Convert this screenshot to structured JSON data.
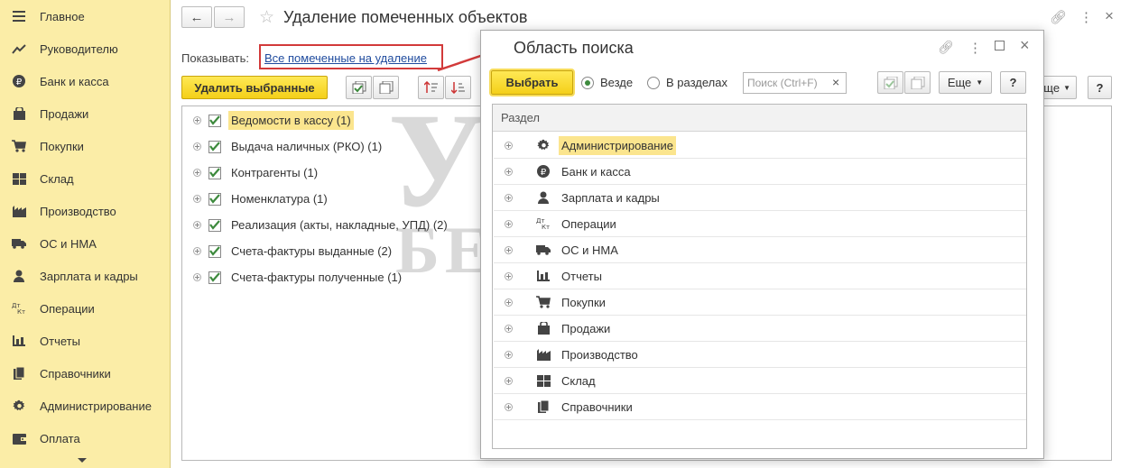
{
  "sidebar": {
    "items": [
      {
        "label": "Главное",
        "icon": "menu-icon"
      },
      {
        "label": "Руководителю",
        "icon": "trend-icon"
      },
      {
        "label": "Банк и касса",
        "icon": "ruble-icon"
      },
      {
        "label": "Продажи",
        "icon": "bag-icon"
      },
      {
        "label": "Покупки",
        "icon": "cart-icon"
      },
      {
        "label": "Склад",
        "icon": "warehouse-icon"
      },
      {
        "label": "Производство",
        "icon": "factory-icon"
      },
      {
        "label": "ОС и НМА",
        "icon": "truck-icon"
      },
      {
        "label": "Зарплата и кадры",
        "icon": "person-icon"
      },
      {
        "label": "Операции",
        "icon": "dt-kt-icon"
      },
      {
        "label": "Отчеты",
        "icon": "bar-chart-icon"
      },
      {
        "label": "Справочники",
        "icon": "books-icon"
      },
      {
        "label": "Администрирование",
        "icon": "gear-icon"
      },
      {
        "label": "Оплата",
        "icon": "wallet-icon"
      }
    ],
    "dt_label": "Дт\nКт"
  },
  "main": {
    "title": "Удаление помеченных объектов",
    "show_label": "Показывать:",
    "show_link": "Все помеченные на удаление",
    "delete_button": "Удалить выбранные",
    "more_button": "Еще",
    "help_button": "?",
    "rows": [
      {
        "label": "Ведомости в кассу (1)",
        "selected": true
      },
      {
        "label": "Выдача наличных (РКО) (1)",
        "selected": false
      },
      {
        "label": "Контрагенты (1)",
        "selected": false
      },
      {
        "label": "Номенклатура (1)",
        "selected": false
      },
      {
        "label": "Реализация (акты, накладные, УПД) (2)",
        "selected": false
      },
      {
        "label": "Счета-фактуры выданные (2)",
        "selected": false
      },
      {
        "label": "Счета-фактуры полученные (1)",
        "selected": false
      }
    ]
  },
  "dialog": {
    "title": "Область поиска",
    "select_button": "Выбрать",
    "radio_everywhere": "Везде",
    "radio_sections": "В разделах",
    "search_placeholder": "Поиск (Ctrl+F)",
    "clear": "×",
    "more_button": "Еще",
    "help_button": "?",
    "column_header": "Раздел",
    "rows": [
      {
        "label": "Администрирование",
        "icon": "gear-icon",
        "selected": true
      },
      {
        "label": "Банк и касса",
        "icon": "ruble-icon",
        "selected": false
      },
      {
        "label": "Зарплата и кадры",
        "icon": "person-icon",
        "selected": false
      },
      {
        "label": "Операции",
        "icon": "dt-kt-icon",
        "selected": false
      },
      {
        "label": "ОС и НМА",
        "icon": "truck-icon",
        "selected": false
      },
      {
        "label": "Отчеты",
        "icon": "bar-chart-icon",
        "selected": false
      },
      {
        "label": "Покупки",
        "icon": "cart-icon",
        "selected": false
      },
      {
        "label": "Продажи",
        "icon": "bag-icon",
        "selected": false
      },
      {
        "label": "Производство",
        "icon": "factory-icon",
        "selected": false
      },
      {
        "label": "Склад",
        "icon": "warehouse-icon",
        "selected": false
      },
      {
        "label": "Справочники",
        "icon": "books-icon",
        "selected": false
      }
    ]
  },
  "watermark": {
    "line1": "УЧЕТ",
    "line2": "БЕЗ ЗАБОТ"
  },
  "colors": {
    "sidebar_bg": "#fbeda7",
    "accent_yellow": "#f4cf19",
    "selection": "#fbe58e",
    "check_green": "#3d8a3d",
    "annotation_red": "#d23a3a"
  }
}
